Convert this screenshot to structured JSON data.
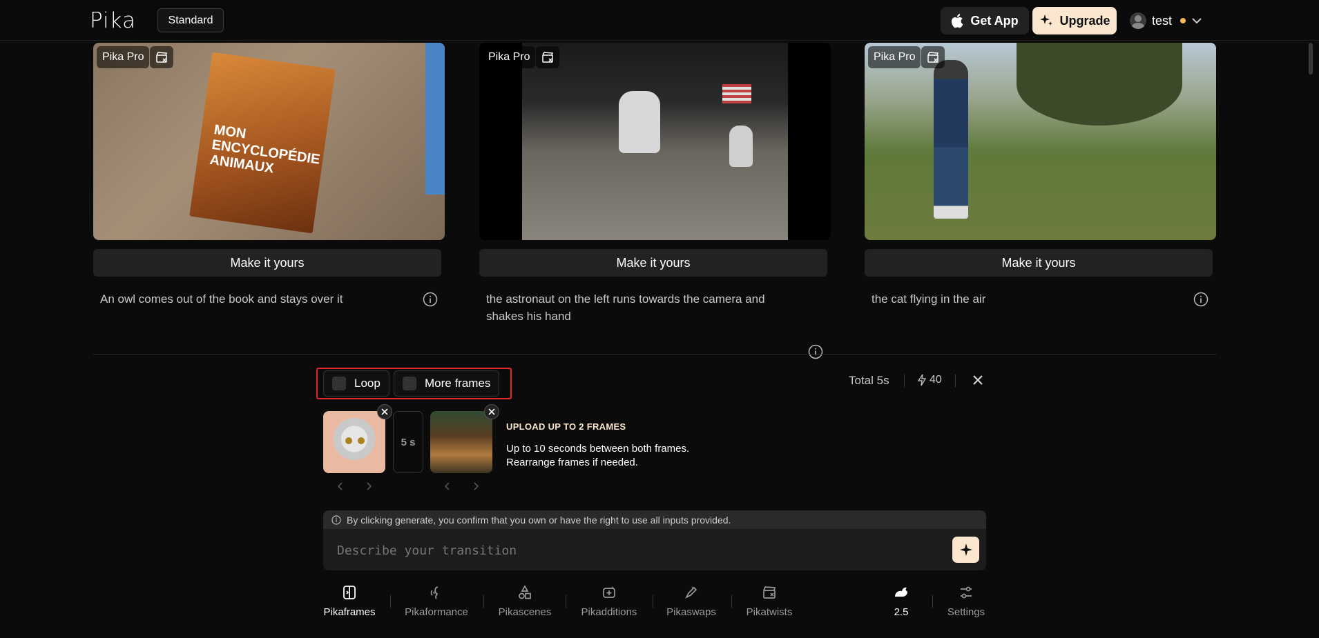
{
  "header": {
    "logo": "Pika",
    "plan_button": "Standard",
    "get_app": "Get App",
    "upgrade": "Upgrade",
    "username": "test"
  },
  "cards": [
    {
      "badge": "Pika Pro",
      "cover_text": "MON ENCYCLOPÉDIE ANIMAUX",
      "button": "Make it yours",
      "caption": "An owl comes out of the book and stays over it"
    },
    {
      "badge": "Pika Pro",
      "button": "Make it yours",
      "caption": "the astronaut on the left runs towards the camera and shakes his hand"
    },
    {
      "badge": "Pika Pro",
      "button": "Make it yours",
      "caption": "the cat flying in the air"
    }
  ],
  "options": {
    "loop": "Loop",
    "more_frames": "More frames",
    "total": "Total 5s",
    "credits": "40"
  },
  "frames": {
    "duration": "5 s",
    "upload_title": "UPLOAD UP TO 2 FRAMES",
    "upload_line1": "Up to 10 seconds between both frames.",
    "upload_line2": "Rearrange frames if needed."
  },
  "prompt": {
    "notice": "By clicking generate, you confirm that you own or have the right to use all inputs provided.",
    "placeholder": "Describe your transition"
  },
  "tools": [
    {
      "label": "Pikaframes",
      "icon": "pikaframes-icon"
    },
    {
      "label": "Pikaformance",
      "icon": "pikaformance-icon"
    },
    {
      "label": "Pikascenes",
      "icon": "pikascenes-icon"
    },
    {
      "label": "Pikadditions",
      "icon": "pikadditions-icon"
    },
    {
      "label": "Pikaswaps",
      "icon": "pikaswaps-icon"
    },
    {
      "label": "Pikatwists",
      "icon": "pikatwists-icon"
    },
    {
      "label": "2.5",
      "icon": "rabbit-model-icon"
    },
    {
      "label": "Settings",
      "icon": "settings-sliders-icon"
    }
  ],
  "colors": {
    "accent": "#fbe7cf",
    "highlight": "#e5252a",
    "background": "#0b0b0b"
  }
}
